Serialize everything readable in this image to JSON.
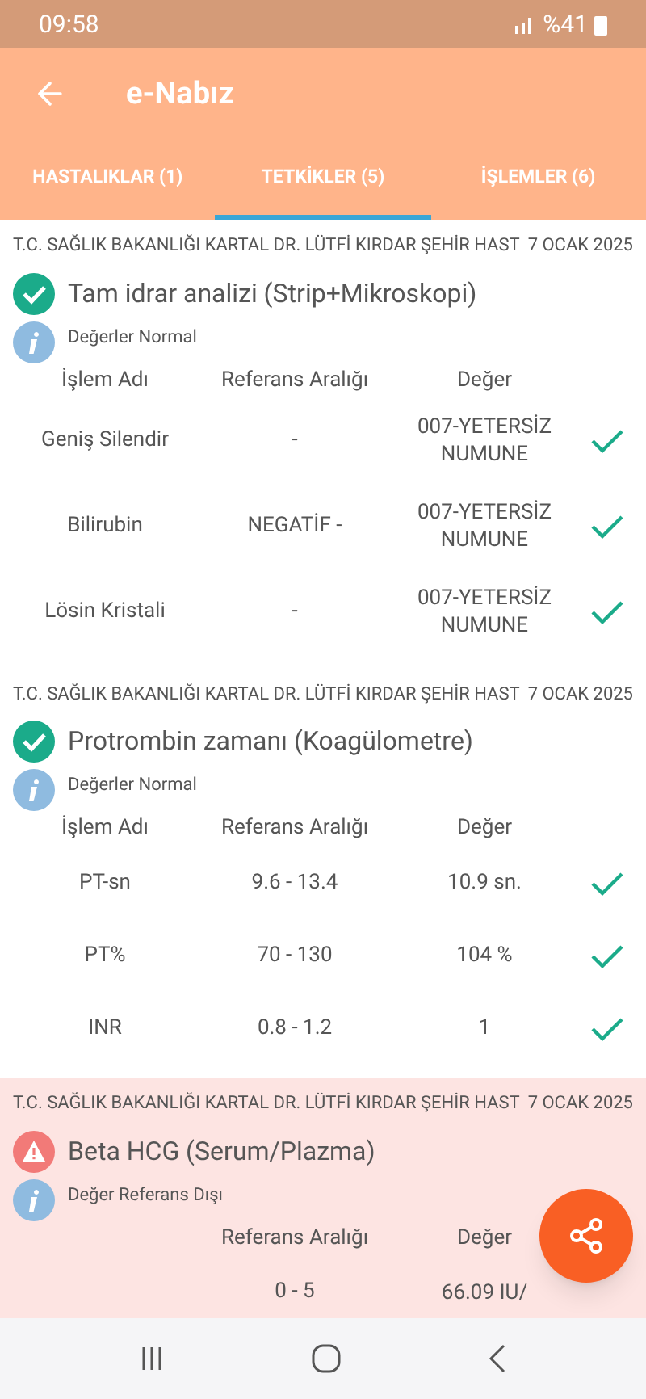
{
  "status_bar": {
    "time": "09:58",
    "battery": "%41"
  },
  "app_bar": {
    "title": "e-Nabız"
  },
  "tabs": [
    {
      "label": "HASTALIKLAR (1)",
      "selected": false
    },
    {
      "label": "TETKİKLER (5)",
      "selected": true
    },
    {
      "label": "İŞLEMLER (6)",
      "selected": false
    }
  ],
  "sections": [
    {
      "kind": "normal",
      "hospital": "T.C. SAĞLIK BAKANLIĞI KARTAL DR. LÜTFİ KIRDAR ŞEHİR HAST",
      "date": "7 OCAK 2025",
      "title": "Tam idrar analizi (Strip+Mikroskopi)",
      "note": "Değerler Normal",
      "columns": {
        "name": "İşlem Adı",
        "reference": "Referans Aralığı",
        "value": "Değer"
      },
      "rows": [
        {
          "name": "Geniş Silendir",
          "reference": "-",
          "value": "007-YETERSİZ NUMUNE",
          "checked": true
        },
        {
          "name": "Bilirubin",
          "reference": "NEGATİF -",
          "value": "007-YETERSİZ NUMUNE",
          "checked": true
        },
        {
          "name": "Lösin Kristali",
          "reference": "-",
          "value": "007-YETERSİZ NUMUNE",
          "checked": true
        }
      ]
    },
    {
      "kind": "normal",
      "hospital": "T.C. SAĞLIK BAKANLIĞI KARTAL DR. LÜTFİ KIRDAR ŞEHİR HAST",
      "date": "7 OCAK 2025",
      "title": "Protrombin zamanı (Koagülometre)",
      "note": "Değerler Normal",
      "columns": {
        "name": "İşlem Adı",
        "reference": "Referans Aralığı",
        "value": "Değer"
      },
      "rows": [
        {
          "name": "PT-sn",
          "reference": "9.6 - 13.4",
          "value": "10.9 sn.",
          "checked": true
        },
        {
          "name": "PT%",
          "reference": "70 - 130",
          "value": "104 %",
          "checked": true
        },
        {
          "name": "INR",
          "reference": "0.8 - 1.2",
          "value": "1",
          "checked": true
        }
      ]
    },
    {
      "kind": "abnormal",
      "hospital": "T.C. SAĞLIK BAKANLIĞI KARTAL DR. LÜTFİ KIRDAR ŞEHİR HAST",
      "date": "7 OCAK 2025",
      "title": "Beta HCG (Serum/Plazma)",
      "note": "Değer Referans Dışı",
      "columns": {
        "reference": "Referans Aralığı",
        "value": "Değer"
      },
      "rows": [
        {
          "reference": "0 - 5",
          "value": "66.09 IU/"
        }
      ]
    }
  ]
}
